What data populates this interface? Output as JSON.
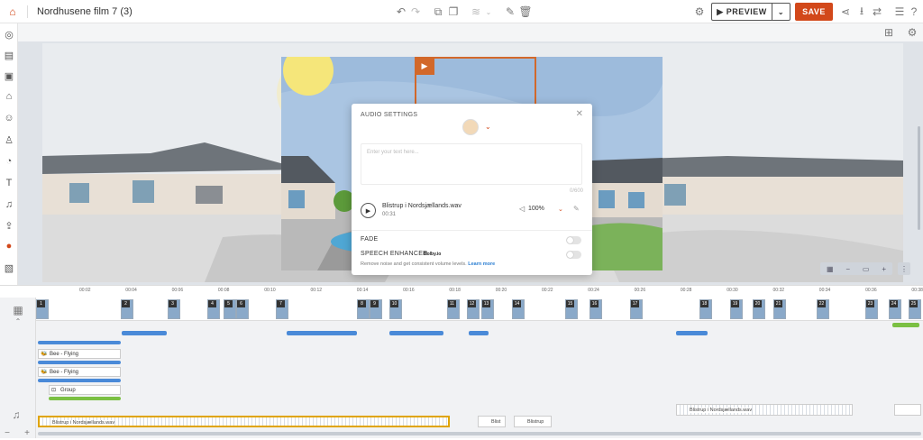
{
  "header": {
    "project_title": "Nordhusene film 7 (3)",
    "preview_label": "PREVIEW",
    "save_label": "SAVE"
  },
  "audio_settings": {
    "title": "AUDIO SETTINGS",
    "text_placeholder": "Enter your text here...",
    "char_counter": "0/600",
    "file_name": "Blistrup i Nordsjællands.wav",
    "duration": "00:31",
    "volume": "100%",
    "fade_label": "FADE",
    "speech_label": "SPEECH ENHANCER",
    "powered_by": "Dolby.io",
    "speech_description": "Remove noise and get consistent volume levels.",
    "learn_more": "Learn more"
  },
  "timeline": {
    "ticks": [
      "00:02",
      "00:04",
      "00:06",
      "00:08",
      "00:10",
      "00:12",
      "00:14",
      "00:16",
      "00:18",
      "00:20",
      "00:22",
      "00:24",
      "00:26",
      "00:28",
      "00:30",
      "00:32",
      "00:34",
      "00:36",
      "00:38"
    ],
    "scene_numbers": [
      "1",
      "2",
      "3",
      "4",
      "5",
      "6",
      "7",
      "8",
      "9",
      "10",
      "11",
      "12",
      "13",
      "14",
      "15",
      "16",
      "17",
      "18",
      "19",
      "20",
      "21",
      "22",
      "23",
      "24",
      "25"
    ],
    "layers": [
      "Bee - Flying",
      "Bee - Flying",
      "Group"
    ],
    "audio_clips": [
      "Blistrup i Nordsjællands.wav",
      "Blist",
      "Blistrup",
      "Blistrup i Nordsjællands.wav"
    ]
  },
  "colors": {
    "accent": "#d2481a",
    "transition": "#4a8ad8",
    "link": "#2d7fd2"
  }
}
